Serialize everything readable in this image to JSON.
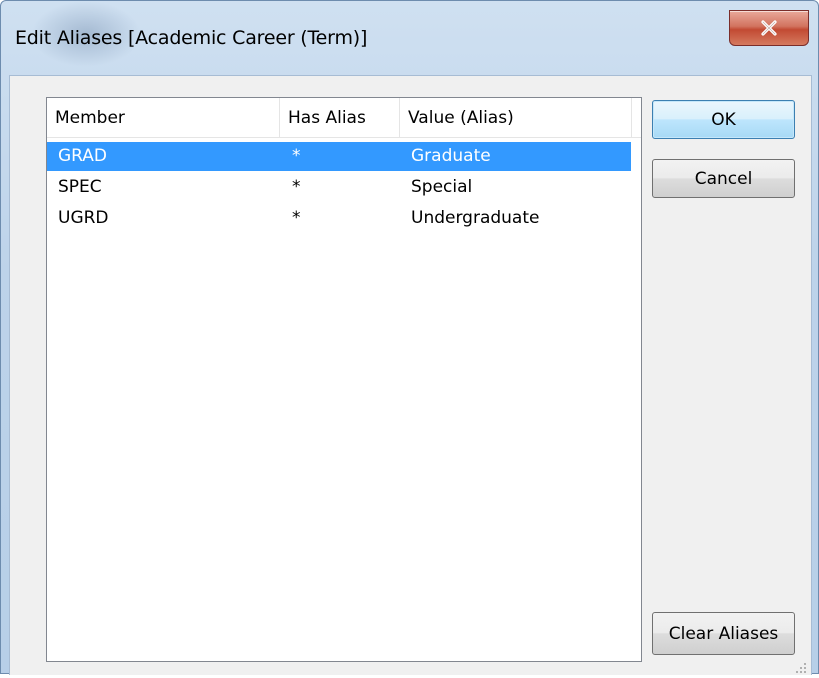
{
  "window": {
    "title": "Edit Aliases [Academic Career (Term)]",
    "close_icon": "close-x-icon"
  },
  "list": {
    "columns": [
      "Member",
      "Has Alias",
      "Value (Alias)"
    ],
    "rows": [
      {
        "member": "GRAD",
        "has_alias": "*",
        "value": "Graduate",
        "selected": true
      },
      {
        "member": "SPEC",
        "has_alias": "*",
        "value": "Special",
        "selected": false
      },
      {
        "member": "UGRD",
        "has_alias": "*",
        "value": "Undergraduate",
        "selected": false
      }
    ],
    "selection_color": "#3399ff"
  },
  "buttons": {
    "ok": "OK",
    "cancel": "Cancel",
    "clear_aliases": "Clear Aliases"
  }
}
